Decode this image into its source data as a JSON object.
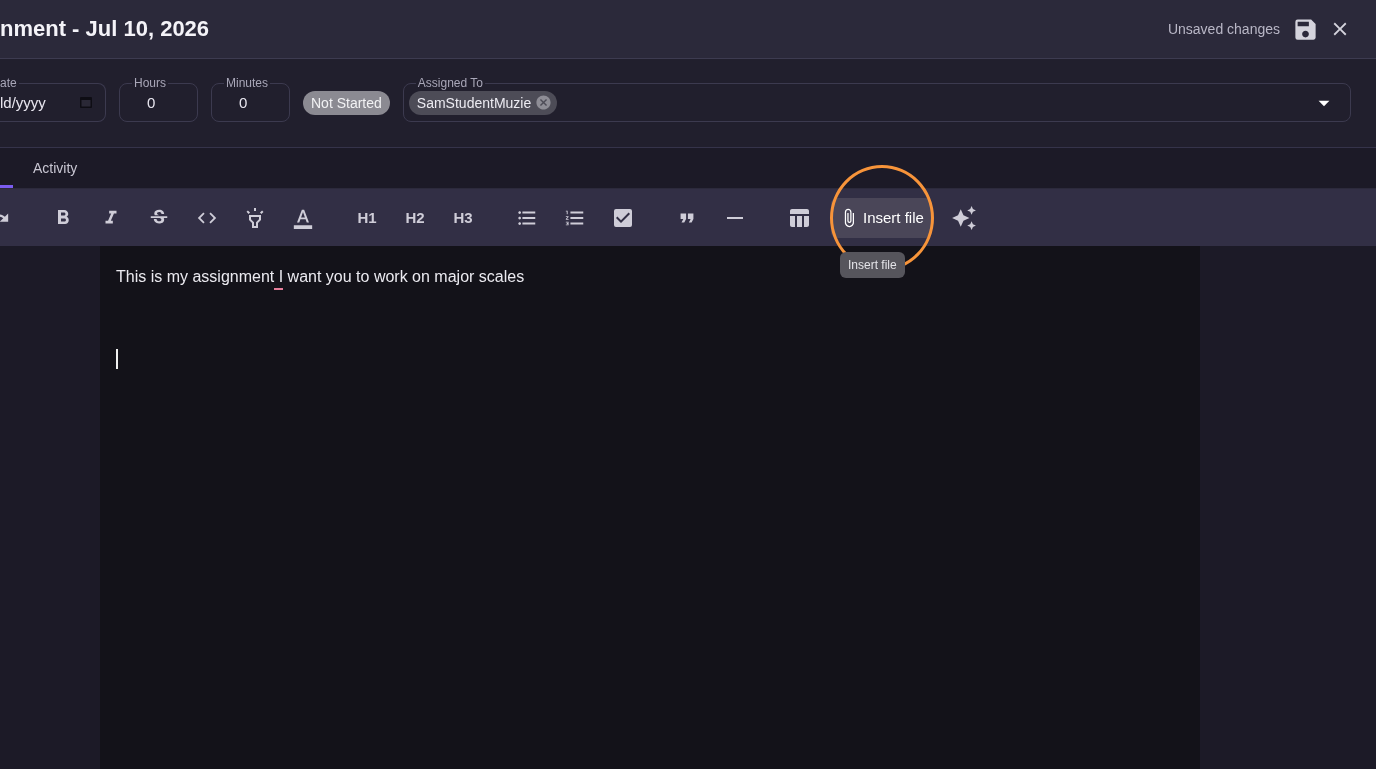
{
  "header": {
    "title": "nment - Jul 10, 2026",
    "status_text": "Unsaved changes"
  },
  "fields": [
    {
      "kind": "date",
      "label": "ate",
      "value": "ld/yyyy"
    },
    {
      "kind": "number",
      "label": "Hours",
      "value": "0"
    },
    {
      "kind": "number",
      "label": "Minutes",
      "value": "0"
    }
  ],
  "status_badge": {
    "label": "Not Started"
  },
  "assigned_to": {
    "label": "Assigned To",
    "chips": [
      "SamStudentMuzie"
    ]
  },
  "tabs": [
    {
      "selected": true
    },
    {
      "label": "Activity",
      "selected": false
    }
  ],
  "toolbar": {
    "groups": [
      [
        {
          "kind": "redo"
        }
      ],
      [
        {
          "kind": "bold"
        },
        {
          "kind": "italic"
        },
        {
          "kind": "strike"
        },
        {
          "kind": "code"
        },
        {
          "kind": "highlight"
        },
        {
          "kind": "text_color"
        }
      ],
      [
        {
          "kind": "heading",
          "label": "H1"
        },
        {
          "kind": "heading",
          "label": "H2"
        },
        {
          "kind": "heading",
          "label": "H3"
        }
      ],
      [
        {
          "kind": "bullet_list"
        },
        {
          "kind": "ordered_list"
        },
        {
          "kind": "task_list"
        }
      ],
      [
        {
          "kind": "quote"
        },
        {
          "kind": "rule"
        }
      ],
      [
        {
          "kind": "table"
        },
        {
          "kind": "insert_file",
          "label": "Insert file",
          "hovered": true,
          "tooltip": "Insert file"
        },
        {
          "kind": "ai"
        }
      ]
    ]
  },
  "editor": {
    "paragraphs": [
      {
        "segments": [
          {
            "text": "This is my assignment",
            "flagged": false
          },
          {
            "text": " I",
            "flagged": true
          },
          {
            "text": " want you to work on major scales",
            "flagged": false
          }
        ]
      }
    ]
  }
}
